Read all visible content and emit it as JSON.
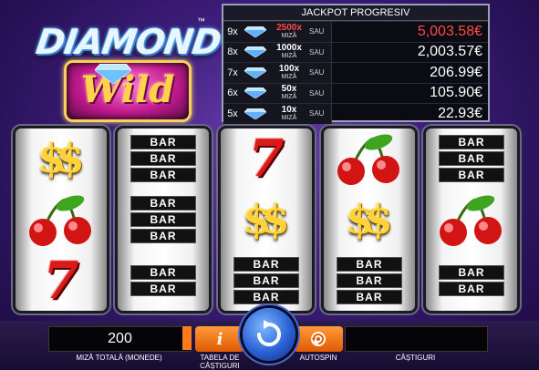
{
  "logo": {
    "line1": "DIAMOND",
    "line2": "Wild",
    "tm": "™"
  },
  "jackpot": {
    "title": "JACKPOT PROGRESIV",
    "rows": [
      {
        "mult": "9x",
        "x": "2500x",
        "x_label": "MIZĂ",
        "or": "SAU",
        "value": "5,003.58€"
      },
      {
        "mult": "8x",
        "x": "1000x",
        "x_label": "MIZĂ",
        "or": "SAU",
        "value": "2,003.57€"
      },
      {
        "mult": "7x",
        "x": "100x",
        "x_label": "MIZĂ",
        "or": "SAU",
        "value": "206.99€"
      },
      {
        "mult": "6x",
        "x": "50x",
        "x_label": "MIZĂ",
        "or": "SAU",
        "value": "105.90€"
      },
      {
        "mult": "5x",
        "x": "10x",
        "x_label": "MIZĂ",
        "or": "SAU",
        "value": "22.93€"
      }
    ]
  },
  "reels": [
    {
      "symbols": [
        "dollar",
        "cherries",
        "seven"
      ]
    },
    {
      "symbols": [
        "triple-bar",
        "triple-bar",
        "double-bar"
      ]
    },
    {
      "symbols": [
        "seven",
        "dollar",
        "triple-bar"
      ]
    },
    {
      "symbols": [
        "cherries",
        "dollar",
        "triple-bar"
      ]
    },
    {
      "symbols": [
        "triple-bar",
        "cherries",
        "double-bar"
      ]
    }
  ],
  "symbol_text": {
    "bar": "BAR",
    "dollar": "$$",
    "seven": "7"
  },
  "controls": {
    "bet_value": "200",
    "bet_label": "MIZĂ TOTALĂ (MONEDE)",
    "info_icon_text": "i",
    "paytable_label": "TABELA DE CÂȘTIGURI",
    "autospin_label": "AUTOSPIN",
    "wins_label": "CÂȘTIGURI",
    "wins_value": ""
  },
  "colors": {
    "accent": "#ff7a1a",
    "jackpot_red": "#ff4a4a",
    "spin_blue": "#2a62d6"
  }
}
